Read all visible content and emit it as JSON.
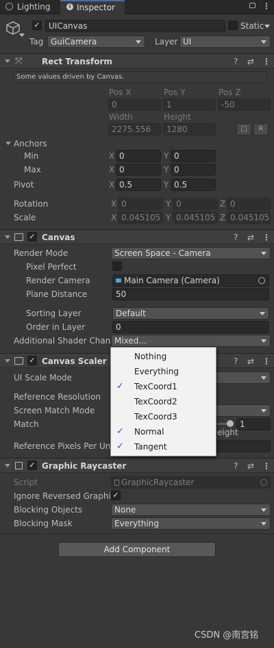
{
  "tabs": {
    "lighting": "Lighting",
    "inspector": "Inspector"
  },
  "object": {
    "name": "UICanvas",
    "static_label": "Static",
    "tag_label": "Tag",
    "tag_value": "GuiCamera",
    "layer_label": "Layer",
    "layer_value": "UI"
  },
  "rect_transform": {
    "title": "Rect Transform",
    "note": "Some values driven by Canvas.",
    "pos_x_label": "Pos X",
    "pos_y_label": "Pos Y",
    "pos_z_label": "Pos Z",
    "pos_x": "0",
    "pos_y": "1",
    "pos_z": "-50",
    "width_label": "Width",
    "height_label": "Height",
    "width": "2275.556",
    "height": "1280",
    "r_button": "R",
    "anchors_label": "Anchors",
    "min_label": "Min",
    "max_label": "Max",
    "min_x": "0",
    "min_y": "0",
    "max_x": "0",
    "max_y": "0",
    "pivot_label": "Pivot",
    "pivot_x": "0.5",
    "pivot_y": "0.5",
    "rotation_label": "Rotation",
    "rot_x": "0",
    "rot_y": "0",
    "rot_z": "0",
    "scale_label": "Scale",
    "scale_x": "0.045105",
    "scale_y": "0.045105",
    "scale_z": "0.045105",
    "x": "X",
    "y": "Y",
    "z": "Z"
  },
  "canvas": {
    "title": "Canvas",
    "render_mode_label": "Render Mode",
    "render_mode": "Screen Space - Camera",
    "pixel_perfect_label": "Pixel Perfect",
    "render_camera_label": "Render Camera",
    "render_camera": "Main Camera (Camera)",
    "plane_distance_label": "Plane Distance",
    "plane_distance": "50",
    "sorting_layer_label": "Sorting Layer",
    "sorting_layer": "Default",
    "order_label": "Order in Layer",
    "order": "0",
    "shader_channels_label": "Additional Shader Chann",
    "shader_channels": "Mixed..."
  },
  "canvas_scaler": {
    "title": "Canvas Scaler",
    "ui_scale_mode_label": "UI Scale Mode",
    "ref_resolution_label": "Reference Resolution",
    "screen_match_label": "Screen Match Mode",
    "match_label": "Match",
    "match_value": "1",
    "height_fragment": "Height",
    "ref_pixels_label": "Reference Pixels Per Uni"
  },
  "shader_popup": {
    "options": [
      {
        "label": "Nothing",
        "checked": false
      },
      {
        "label": "Everything",
        "checked": false
      },
      {
        "label": "TexCoord1",
        "checked": true
      },
      {
        "label": "TexCoord2",
        "checked": false
      },
      {
        "label": "TexCoord3",
        "checked": false
      },
      {
        "label": "Normal",
        "checked": true
      },
      {
        "label": "Tangent",
        "checked": true
      }
    ]
  },
  "graphic_raycaster": {
    "title": "Graphic Raycaster",
    "script_label": "Script",
    "script_value": "GraphicRaycaster",
    "ignore_reversed_label": "Ignore Reversed Graphic",
    "blocking_objects_label": "Blocking Objects",
    "blocking_objects": "None",
    "blocking_mask_label": "Blocking Mask",
    "blocking_mask": "Everything"
  },
  "add_component": "Add Component",
  "watermark": "CSDN @南宫铭"
}
